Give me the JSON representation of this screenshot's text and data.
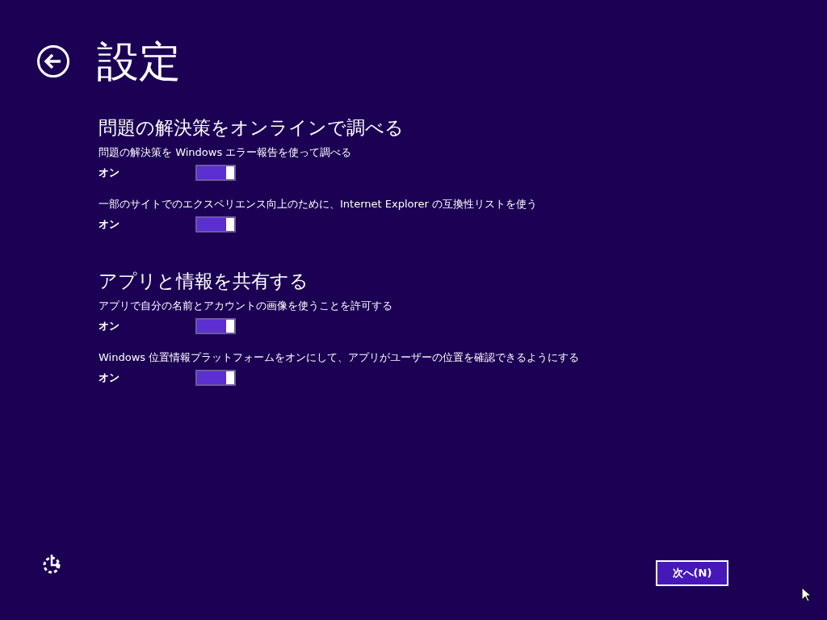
{
  "title": "設定",
  "sections": [
    {
      "heading": "問題の解決策をオンラインで調べる",
      "settings": [
        {
          "label": "問題の解決策を Windows エラー報告を使って調べる",
          "state_text": "オン",
          "on": true
        },
        {
          "label": "一部のサイトでのエクスペリエンス向上のために、Internet Explorer の互換性リストを使う",
          "state_text": "オン",
          "on": true
        }
      ]
    },
    {
      "heading": "アプリと情報を共有する",
      "settings": [
        {
          "label": "アプリで自分の名前とアカウントの画像を使うことを許可する",
          "state_text": "オン",
          "on": true
        },
        {
          "label": "Windows 位置情報プラットフォームをオンにして、アプリがユーザーの位置を確認できるようにする",
          "state_text": "オン",
          "on": true
        }
      ]
    }
  ],
  "next_button": "次へ(N)"
}
